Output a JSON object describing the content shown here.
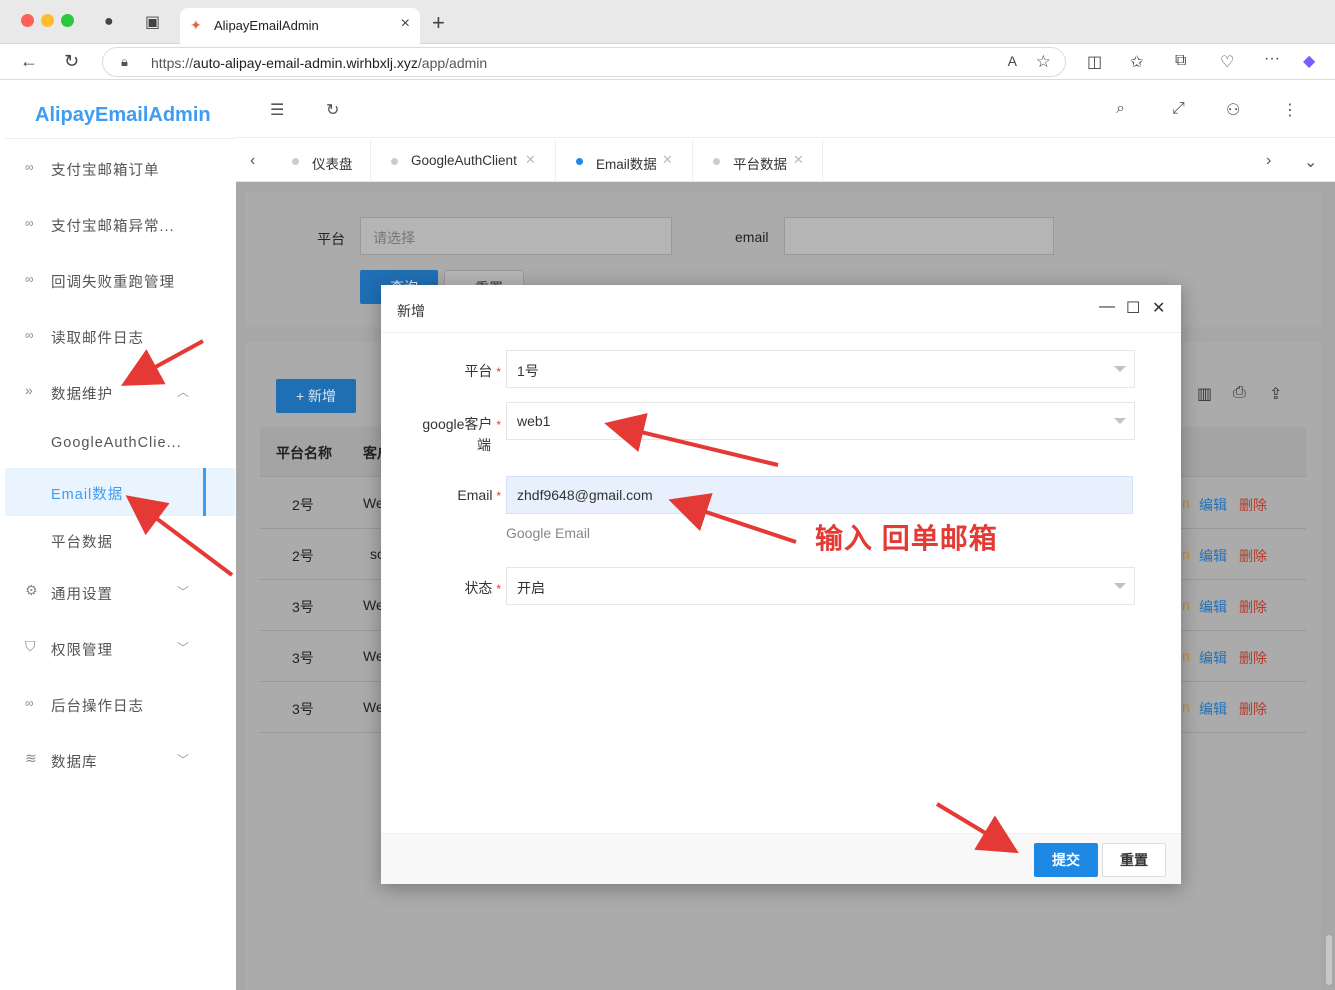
{
  "browser": {
    "tab_title": "AlipayEmailAdmin",
    "url_prefix": "https://",
    "url_host": "auto-alipay-email-admin.wirhbxlj.xyz",
    "url_path": "/app/admin"
  },
  "app": {
    "logo": "AlipayEmailAdmin",
    "sidebar": {
      "items": [
        {
          "label": "支付宝邮箱订单"
        },
        {
          "label": "支付宝邮箱异常..."
        },
        {
          "label": "回调失败重跑管理"
        },
        {
          "label": "读取邮件日志"
        },
        {
          "label": "数据维护"
        },
        {
          "label": "GoogleAuthClie..."
        },
        {
          "label": "Email数据"
        },
        {
          "label": "平台数据"
        },
        {
          "label": "通用设置"
        },
        {
          "label": "权限管理"
        },
        {
          "label": "后台操作日志"
        },
        {
          "label": "数据库"
        }
      ]
    },
    "page_tabs": [
      {
        "label": "仪表盘"
      },
      {
        "label": "GoogleAuthClient"
      },
      {
        "label": "Email数据"
      },
      {
        "label": "平台数据"
      }
    ],
    "filter": {
      "platform_label": "平台",
      "platform_placeholder": "请选择",
      "email_label": "email",
      "search_button": "查询",
      "reset_button": "重置"
    },
    "table": {
      "add_button": "+ 新增",
      "headers": [
        "平台名称",
        "客户"
      ],
      "rows": [
        {
          "platform": "2号",
          "client": "We"
        },
        {
          "platform": "2号",
          "client": "sc"
        },
        {
          "platform": "3号",
          "client": "We"
        },
        {
          "platform": "3号",
          "client": "We"
        },
        {
          "platform": "3号",
          "client": "We"
        }
      ],
      "action_partial": "n",
      "action_edit": "编辑",
      "action_delete": "删除"
    }
  },
  "modal": {
    "title": "新增",
    "fields": {
      "platform_label": "平台",
      "platform_value": "1号",
      "client_label_line1": "google客户",
      "client_label_line2": "端",
      "client_value": "web1",
      "email_label": "Email",
      "email_value": "zhdf9648@gmail.com",
      "email_hint": "Google Email",
      "status_label": "状态",
      "status_value": "开启",
      "required_mark": "*"
    },
    "submit_button": "提交",
    "reset_button": "重置"
  },
  "annotation": {
    "text": "输入  回单邮箱",
    "color": "#e53935"
  }
}
